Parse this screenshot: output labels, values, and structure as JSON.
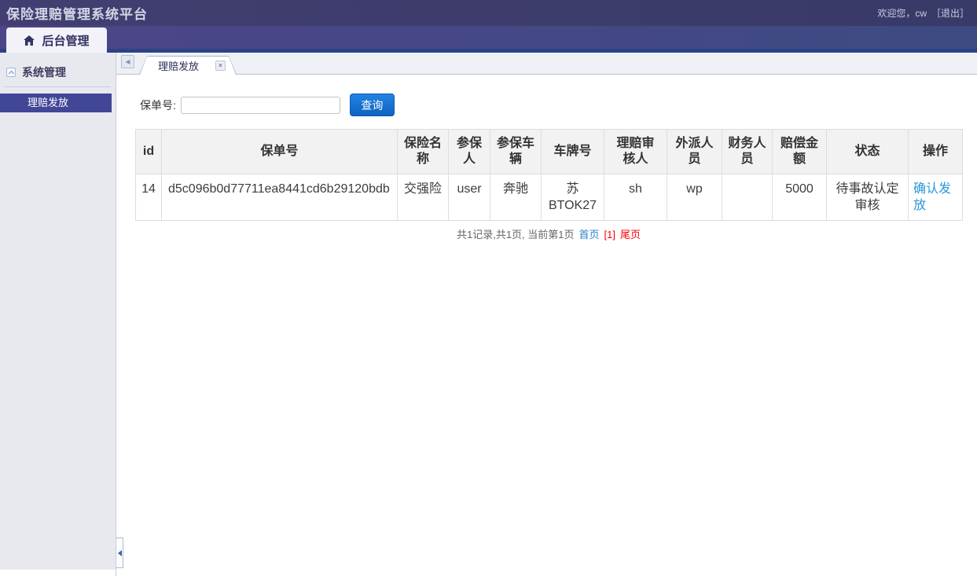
{
  "header": {
    "title": "保险理赔管理系统平台",
    "welcome": "欢迎您，cw",
    "logout": "［退出］"
  },
  "nav": {
    "tab_label": "后台管理"
  },
  "sidebar": {
    "group_label": "系统管理",
    "items": [
      {
        "label": "理赔发放",
        "selected": true
      }
    ]
  },
  "icons": {
    "home": "⌂",
    "tabs_scroll_left": "◀",
    "tab_close": "✕"
  },
  "main": {
    "tab_label": "理赔发放",
    "search": {
      "label": "保单号:",
      "value": "",
      "button_label": "查询"
    },
    "table": {
      "headers": [
        "id",
        "保单号",
        "保险名\n称",
        "参保\n人",
        "参保车\n辆",
        "车牌号",
        "理赔审\n核人",
        "外派人\n员",
        "财务人\n员",
        "赔偿金\n额",
        "状态",
        "操作"
      ],
      "rows": [
        {
          "id": "14",
          "policy_no": "d5c096b0d77711ea8441cd6b29120bdb",
          "insurance_name": "交强险",
          "insured_person": "user",
          "insured_vehicle": "奔驰",
          "plate_no": "苏BTOK27",
          "claim_auditor": "sh",
          "dispatch_staff": "wp",
          "finance_staff": "",
          "compensation": "5000",
          "status": "待事故认定审核",
          "action": "确认发放"
        }
      ]
    },
    "pagination": {
      "summary": "共1记录,共1页, 当前第1页",
      "first": "首页",
      "current": "[1]",
      "last": "尾页"
    }
  },
  "colors": {
    "topbar": "#3a3b69",
    "navbar": "#454585",
    "navbar_strip": "#2c4287",
    "sidebar_bg": "#e8e9ef",
    "selected_item": "#414696",
    "button_blue": "#1268c3",
    "link_blue": "#2a97d8",
    "pagination_red": "#ff0000",
    "header_bg": "#f2f2f2"
  }
}
